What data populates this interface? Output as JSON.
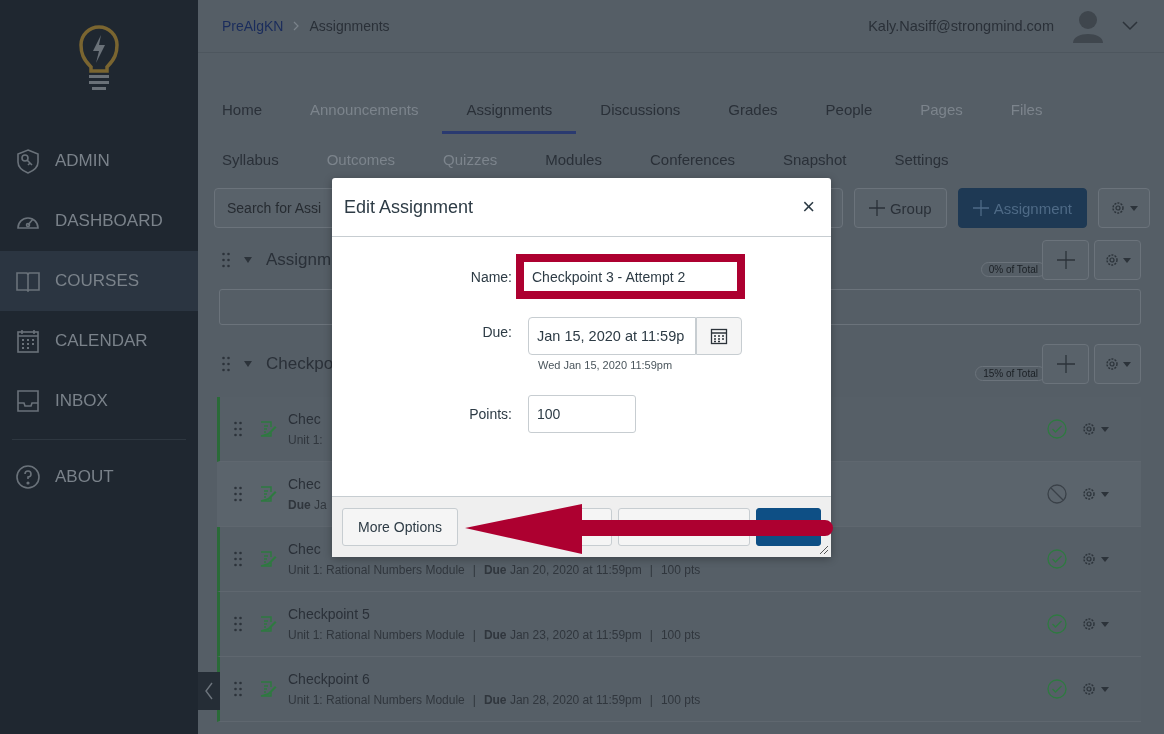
{
  "sidebar": {
    "items": [
      {
        "label": "ADMIN",
        "kind": "shield",
        "selected": false
      },
      {
        "label": "DASHBOARD",
        "kind": "gauge",
        "selected": false
      },
      {
        "label": "COURSES",
        "kind": "book",
        "selected": true
      },
      {
        "label": "CALENDAR",
        "kind": "calendar",
        "selected": false
      },
      {
        "label": "INBOX",
        "kind": "inbox",
        "selected": false
      },
      {
        "label": "ABOUT",
        "kind": "help",
        "selected": false
      }
    ]
  },
  "breadcrumb": [
    "PreAlgKN",
    "Assignments"
  ],
  "user": {
    "email": "Kaly.Nasiff@strongmind.com"
  },
  "tab_rows": [
    [
      {
        "label": "Home",
        "selected": false,
        "disabled": false
      },
      {
        "label": "Announcements",
        "selected": false,
        "disabled": true
      },
      {
        "label": "Assignments",
        "selected": true,
        "disabled": false
      },
      {
        "label": "Discussions",
        "selected": false,
        "disabled": false
      },
      {
        "label": "Grades",
        "selected": false,
        "disabled": false
      },
      {
        "label": "People",
        "selected": false,
        "disabled": false
      },
      {
        "label": "Pages",
        "selected": false,
        "disabled": true
      },
      {
        "label": "Files",
        "selected": false,
        "disabled": true
      }
    ],
    [
      {
        "label": "Syllabus",
        "selected": false,
        "disabled": false
      },
      {
        "label": "Outcomes",
        "selected": false,
        "disabled": true
      },
      {
        "label": "Quizzes",
        "selected": false,
        "disabled": true
      },
      {
        "label": "Modules",
        "selected": false,
        "disabled": false
      },
      {
        "label": "Conferences",
        "selected": false,
        "disabled": false
      },
      {
        "label": "Snapshot",
        "selected": false,
        "disabled": false
      },
      {
        "label": "Settings",
        "selected": false,
        "disabled": false
      }
    ]
  ],
  "toolbar": {
    "search": {
      "placeholder": "Search for Assi"
    },
    "buttons": [
      {
        "label": "Group",
        "kind": "default"
      },
      {
        "label": "Assignment",
        "kind": "primary"
      }
    ]
  },
  "groups": [
    {
      "name": "Assignm",
      "weight": "0% of Total"
    },
    {
      "name": "Checkpo",
      "weight": "15% of Total",
      "assignments": [
        {
          "title": "Chec",
          "details": [
            "Unit 1:"
          ],
          "published": true
        },
        {
          "title": "Chec",
          "details": [
            "**Due** Ja"
          ],
          "published": false
        },
        {
          "title": "Chec",
          "details": [
            "Unit 1: Rational Numbers Module",
            "|",
            "**Due** Jan 20, 2020 at 11:59pm",
            "|",
            "100 pts"
          ],
          "published": true
        },
        {
          "title": "Checkpoint 5",
          "details": [
            "Unit 1: Rational Numbers Module",
            "|",
            "**Due** Jan 23, 2020 at 11:59pm",
            "|",
            "100 pts"
          ],
          "published": true
        },
        {
          "title": "Checkpoint 6",
          "details": [
            "Unit 1: Rational Numbers Module",
            "|",
            "**Due** Jan 28, 2020 at 11:59pm",
            "|",
            "100 pts"
          ],
          "published": true
        }
      ]
    }
  ],
  "dialog": {
    "title": "Edit Assignment",
    "close": "×",
    "name": {
      "label": "Name:",
      "value": "Checkpoint 3 - Attempt 2"
    },
    "due": {
      "label": "Due:",
      "value": "Jan 15, 2020 at 11:59p",
      "hint": "Wed Jan 15, 2020 11:59pm"
    },
    "points": {
      "label": "Points:",
      "value": "100"
    },
    "more_options": "More Options",
    "footer_buttons": [
      {
        "kind": "default"
      },
      {
        "kind": "default"
      },
      {
        "kind": "primary"
      }
    ]
  }
}
